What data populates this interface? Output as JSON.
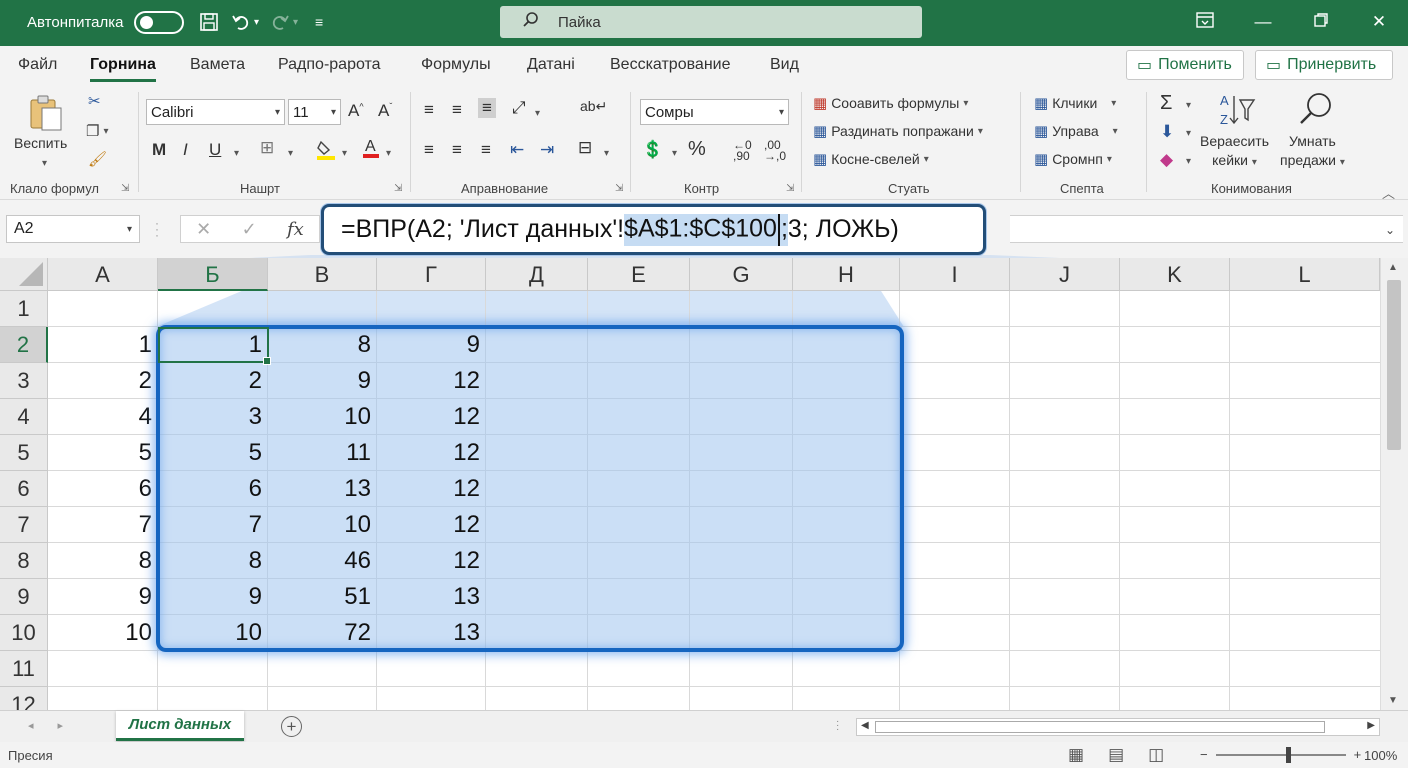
{
  "titlebar": {
    "autosave_label": "Автонпиталка",
    "search_placeholder": "Пайка"
  },
  "menu": {
    "tabs": [
      "Файл",
      "Горнина",
      "Вамета",
      "Радпо-рарота",
      "Формулы",
      "Датані",
      "Весскатрование",
      "Вид"
    ],
    "active_tab": "Горнина",
    "comments_button": "Поменить",
    "share_button": "Принервить"
  },
  "ribbon": {
    "clipboard": {
      "paste_label": "Веспить",
      "group_label": "Клало формул"
    },
    "font": {
      "name": "Calibri",
      "size": "11",
      "group_label": "Нашрт",
      "bold": "M",
      "italic": "I",
      "underline": "U"
    },
    "alignment": {
      "group_label": "Аправнование"
    },
    "number": {
      "format": "Сомры",
      "group_label": "Контр"
    },
    "styles": {
      "items": [
        "Сооавить формулы",
        "Раздинать попражани",
        "Косне-свелей"
      ],
      "group_label": "Стуать"
    },
    "cells": {
      "items": [
        "Клчики",
        "Управа",
        "Сромнп"
      ],
      "group_label": "Спепта"
    },
    "editing": {
      "sort_label_1": "Вераесить",
      "sort_label_2": "кейки",
      "find_label_1": "Умнать",
      "find_label_2": "предажи",
      "group_label": "Конимования"
    }
  },
  "formula_bar": {
    "name_box": "A2",
    "formula_prefix": "=ВПР(A2; 'Лист данных'!",
    "formula_highlight": "$A$1:$C$100",
    "formula_highlight_tail": ";",
    "formula_suffix": " 3; ЛОЖЬ)"
  },
  "grid": {
    "columns": [
      "A",
      "Б",
      "В",
      "Г",
      "Д",
      "E",
      "G",
      "H",
      "I",
      "J",
      "K",
      "L"
    ],
    "selected_column": "Б",
    "rows": [
      "1",
      "2",
      "3",
      "4",
      "5",
      "6",
      "7",
      "8",
      "9",
      "10",
      "11",
      "12"
    ],
    "selected_row": "2",
    "cells": [
      [
        "",
        "",
        "",
        ""
      ],
      [
        "1",
        "1",
        "8",
        "9"
      ],
      [
        "2",
        "2",
        "9",
        "12"
      ],
      [
        "4",
        "3",
        "10",
        "12"
      ],
      [
        "5",
        "5",
        "11",
        "12"
      ],
      [
        "6",
        "6",
        "13",
        "12"
      ],
      [
        "7",
        "7",
        "10",
        "12"
      ],
      [
        "8",
        "8",
        "46",
        "12"
      ],
      [
        "9",
        "9",
        "51",
        "13"
      ],
      [
        "10",
        "10",
        "72",
        "13"
      ],
      [
        "",
        "",
        "",
        ""
      ],
      [
        "",
        "",
        "",
        ""
      ]
    ]
  },
  "sheets": {
    "tabs": [
      "Лист данных"
    ],
    "active": "Лист данных"
  },
  "status": {
    "text": "Пресия",
    "zoom": "100%"
  },
  "colors": {
    "brand": "#217346",
    "range_border": "#1565c0",
    "range_fill": "#a0c4ee"
  }
}
